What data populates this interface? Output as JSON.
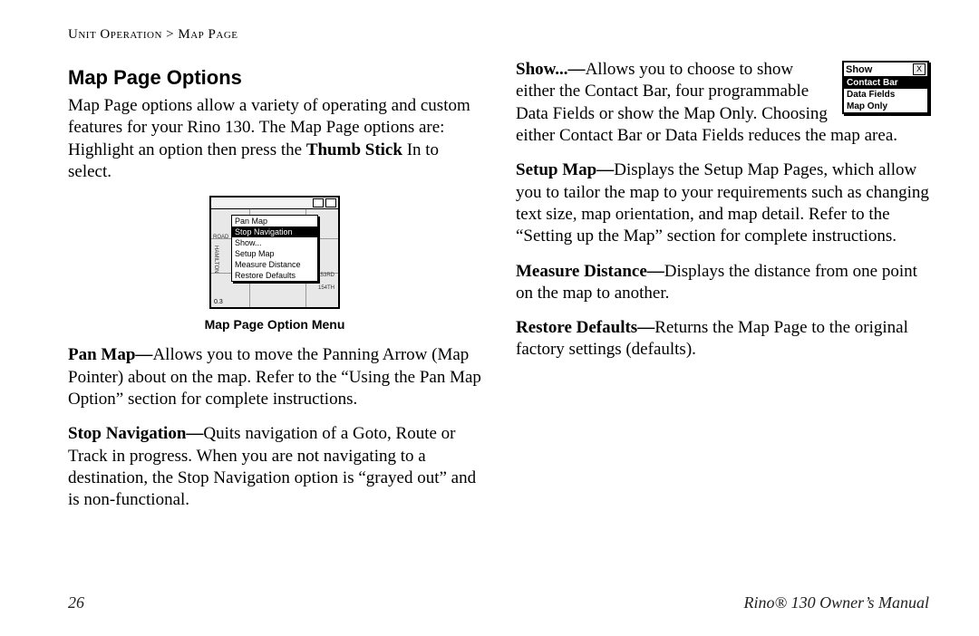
{
  "breadcrumb": {
    "section": "Unit Operation",
    "sep": ">",
    "page": "Map Page"
  },
  "heading": "Map Page Options",
  "intro": {
    "pre": "Map Page options allow a variety of operating and custom features for your Rino 130. The Map Page options are: Highlight an option then press the ",
    "bold": "Thumb Stick",
    "post": " In to select."
  },
  "figure": {
    "caption": "Map Page Option Menu",
    "menu": {
      "items": [
        "Pan Map",
        "Stop Navigation",
        "Show...",
        "Setup Map",
        "Measure Distance",
        "Restore Defaults"
      ],
      "selected_index": 1
    },
    "map_labels": {
      "road": "ROAD",
      "left_street": "HAMILTON",
      "right_num1": "153RD",
      "right_num2": "154TH"
    },
    "scale": "0.3",
    "source": "mapsource"
  },
  "left_paras": [
    {
      "lead": "Pan Map—",
      "text": "Allows you to move the Panning Arrow (Map Pointer) about on the map. Refer to the “Using the Pan Map Option” section for complete instructions."
    },
    {
      "lead": "Stop Navigation—",
      "text": "Quits navigation of a Goto, Route or Track in progress. When you are not navigating to a destination, the Stop Navigation option is “grayed out” and is non-functional."
    }
  ],
  "show_widget": {
    "title": "Show",
    "close": "X",
    "options": [
      "Contact Bar",
      "Data Fields",
      "Map Only"
    ],
    "selected_index": 0
  },
  "right_paras": [
    {
      "lead": "Show...—",
      "text": "Allows you to choose to show either the Contact Bar, four programmable Data Fields or show the Map Only. Choosing either Contact Bar or Data Fields reduces the map area."
    },
    {
      "lead": "Setup Map—",
      "text": "Displays the Setup Map Pages, which allow you to tailor the map to your requirements such as changing text size, map orientation, and map detail. Refer to the “Setting up the Map” section for complete instructions."
    },
    {
      "lead": "Measure Distance—",
      "text": "Displays the distance from one point on the map to another."
    },
    {
      "lead": "Restore Defaults—",
      "text": "Returns the Map Page to the original factory settings (defaults)."
    }
  ],
  "footer": {
    "page_number": "26",
    "manual": "Rino® 130 Owner’s Manual"
  }
}
